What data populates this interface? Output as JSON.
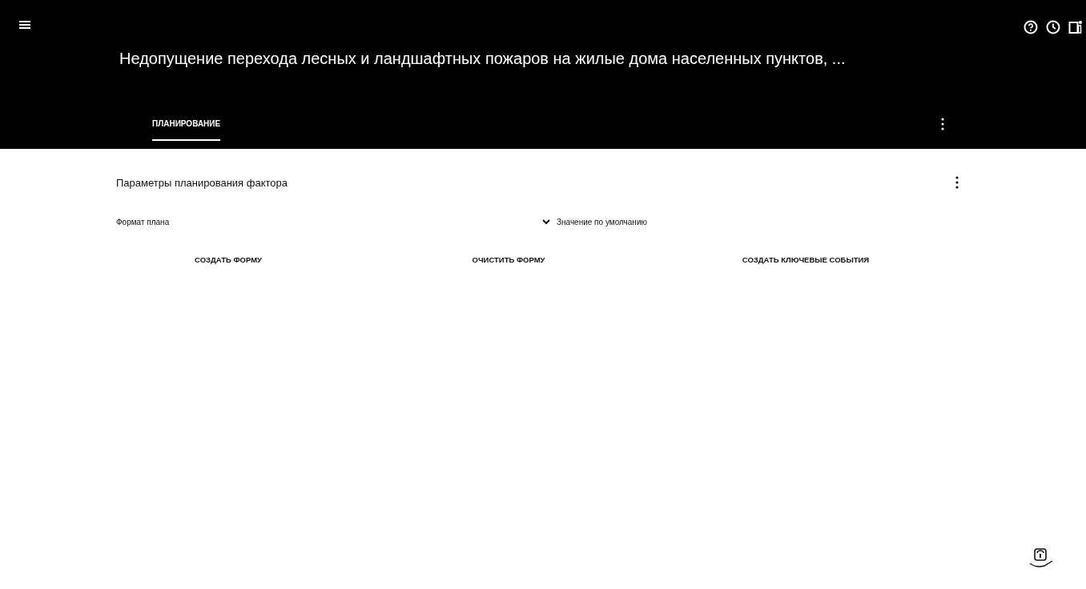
{
  "header": {
    "title": "Недопущение перехода лесных и ландшафтных пожаров на жилые дома населенных пунктов, ..."
  },
  "tabs": [
    {
      "label": "ПЛАНИРОВАНИЕ",
      "selected": true
    }
  ],
  "section": {
    "title": "Параметры планирования фактора"
  },
  "fields": [
    {
      "label": "Формат плана",
      "value": "Значение по умолчанию"
    }
  ],
  "buttons": [
    "СОЗДАТЬ ФОРМУ",
    "ОЧИСТИТЬ ФОРМУ",
    "СОЗДАТЬ КЛЮЧЕВЫЕ СОБЫТИЯ"
  ]
}
